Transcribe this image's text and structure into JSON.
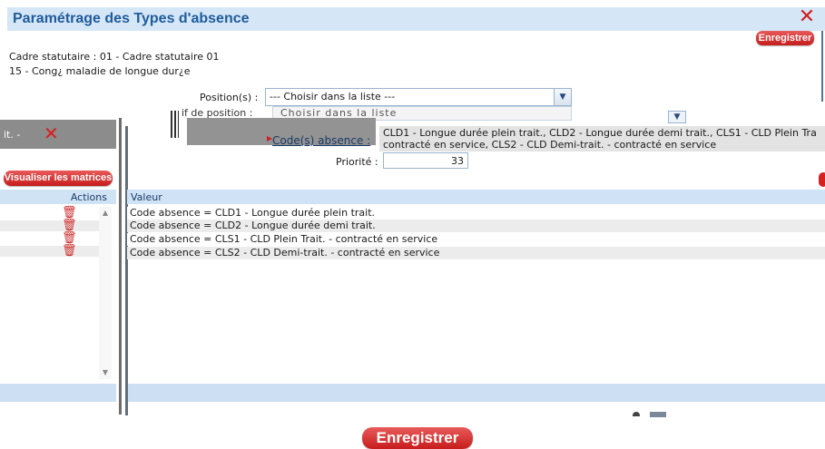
{
  "window": {
    "title": "Paramétrage des Types d'absence",
    "save_top": "Enregistrer",
    "cadre_line": "Cadre statutaire : 01 - Cadre statutaire 01",
    "type_line": "15 - Cong¿ maladie de longue dur¿e"
  },
  "form": {
    "position_label": "Position(s) :",
    "position_value": "--- Choisir dans la liste ---",
    "motif_label": "if de position :",
    "motif_value": "Choisir dans la liste",
    "code_label": "Code(s) absence :",
    "code_value_line1": "CLD1 - Longue durée plein trait., CLD2 - Longue durée demi trait., CLS1 - CLD Plein Tra",
    "code_value_line2": "contracté en service, CLS2 - CLD Demi-trait. - contracté en service",
    "priority_label": "Priorité :",
    "priority_value": "33"
  },
  "left_panel": {
    "header_text": "it. -",
    "visualise_button": "Visualiser les matrices",
    "actions_header": "Actions",
    "rows": 4
  },
  "table": {
    "header": "Valeur",
    "rows": [
      "Code absence = CLD1 - Longue durée plein trait.",
      "Code absence = CLD2 - Longue durée demi trait.",
      "Code absence = CLS1 - CLD Plein Trait. - contracté en service",
      "Code absence = CLS2 - CLD Demi-trait. - contracté en service"
    ]
  },
  "footer": {
    "save_bottom": "Enregistrer"
  },
  "colors": {
    "accent_red": "#c71c1c",
    "title_blue": "#1f5c9c",
    "header_blue": "#cfe2f6"
  },
  "icons": [
    "close-icon",
    "dropdown-icon",
    "trash-icon",
    "scroll-up-icon",
    "scroll-down-icon"
  ]
}
